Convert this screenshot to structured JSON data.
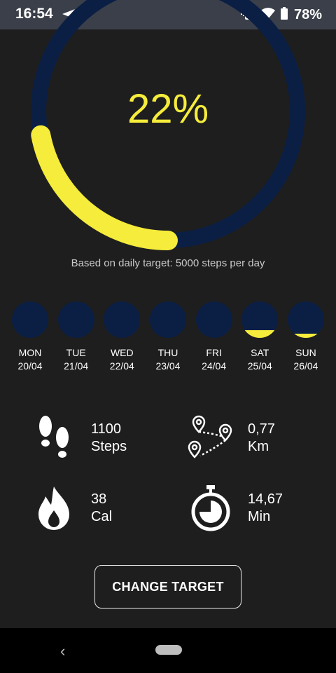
{
  "status_bar": {
    "time": "16:54",
    "battery": "78%",
    "icons": [
      "navigation-icon",
      "parking-icon",
      "vibrate-icon",
      "wifi-icon",
      "battery-icon"
    ]
  },
  "progress": {
    "percent_label": "22%",
    "fraction": 0.22,
    "note": "Based on daily target: 5000 steps per day",
    "colors": {
      "track": "#0b1f44",
      "fill": "#f5ec3b"
    }
  },
  "week": [
    {
      "name": "MON",
      "date": "20/04",
      "fill": 0.0
    },
    {
      "name": "TUE",
      "date": "21/04",
      "fill": 0.0
    },
    {
      "name": "WED",
      "date": "22/04",
      "fill": 0.0
    },
    {
      "name": "THU",
      "date": "23/04",
      "fill": 0.0
    },
    {
      "name": "FRI",
      "date": "24/04",
      "fill": 0.0
    },
    {
      "name": "SAT",
      "date": "25/04",
      "fill": 0.22
    },
    {
      "name": "SUN",
      "date": "26/04",
      "fill": 0.12
    }
  ],
  "stats": {
    "steps": {
      "value": "1100",
      "unit": "Steps",
      "icon": "footprints-icon"
    },
    "distance": {
      "value": "0,77",
      "unit": "Km",
      "icon": "route-pins-icon"
    },
    "calories": {
      "value": "38",
      "unit": "Cal",
      "icon": "flame-icon"
    },
    "duration": {
      "value": "14,67",
      "unit": "Min",
      "icon": "stopwatch-icon"
    }
  },
  "actions": {
    "change_target": "CHANGE TARGET"
  }
}
